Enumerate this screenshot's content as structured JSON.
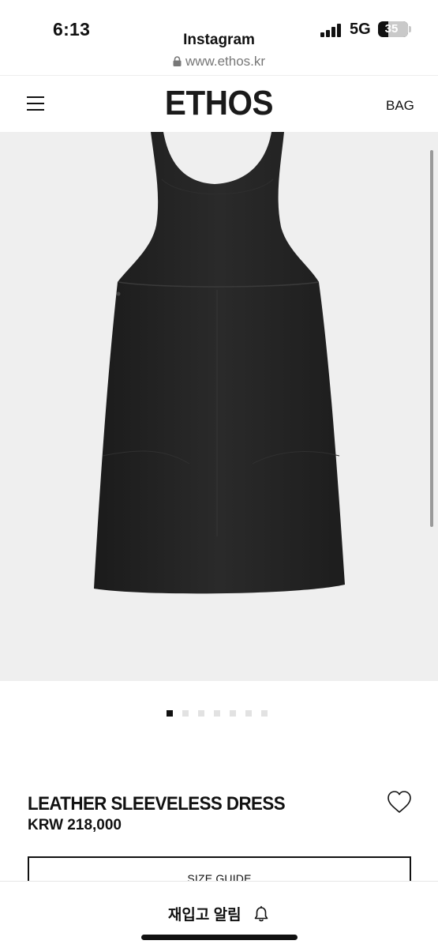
{
  "status_bar": {
    "time": "6:13",
    "app_name": "Instagram",
    "url": "www.ethos.kr",
    "network": "5G",
    "battery": "35",
    "battery_level": 0.35
  },
  "header": {
    "logo": "ETHOS",
    "bag_label": "BAG",
    "menu_icon": "hamburger-menu-icon"
  },
  "gallery": {
    "image_alt": "black leather sleeveless dress",
    "total_images": 7,
    "current_index": 1
  },
  "product": {
    "name": "LEATHER SLEEVELESS DRESS",
    "price": "KRW 218,000",
    "wishlist_icon": "heart-outline-icon",
    "size_guide_label": "SIZE GUIDE"
  },
  "bottom_bar": {
    "restock_label": "재입고 알림",
    "restock_icon": "bell-icon"
  },
  "colors": {
    "background": "#ffffff",
    "image_background": "#efefef",
    "text": "#111111",
    "dress": "#222222"
  }
}
